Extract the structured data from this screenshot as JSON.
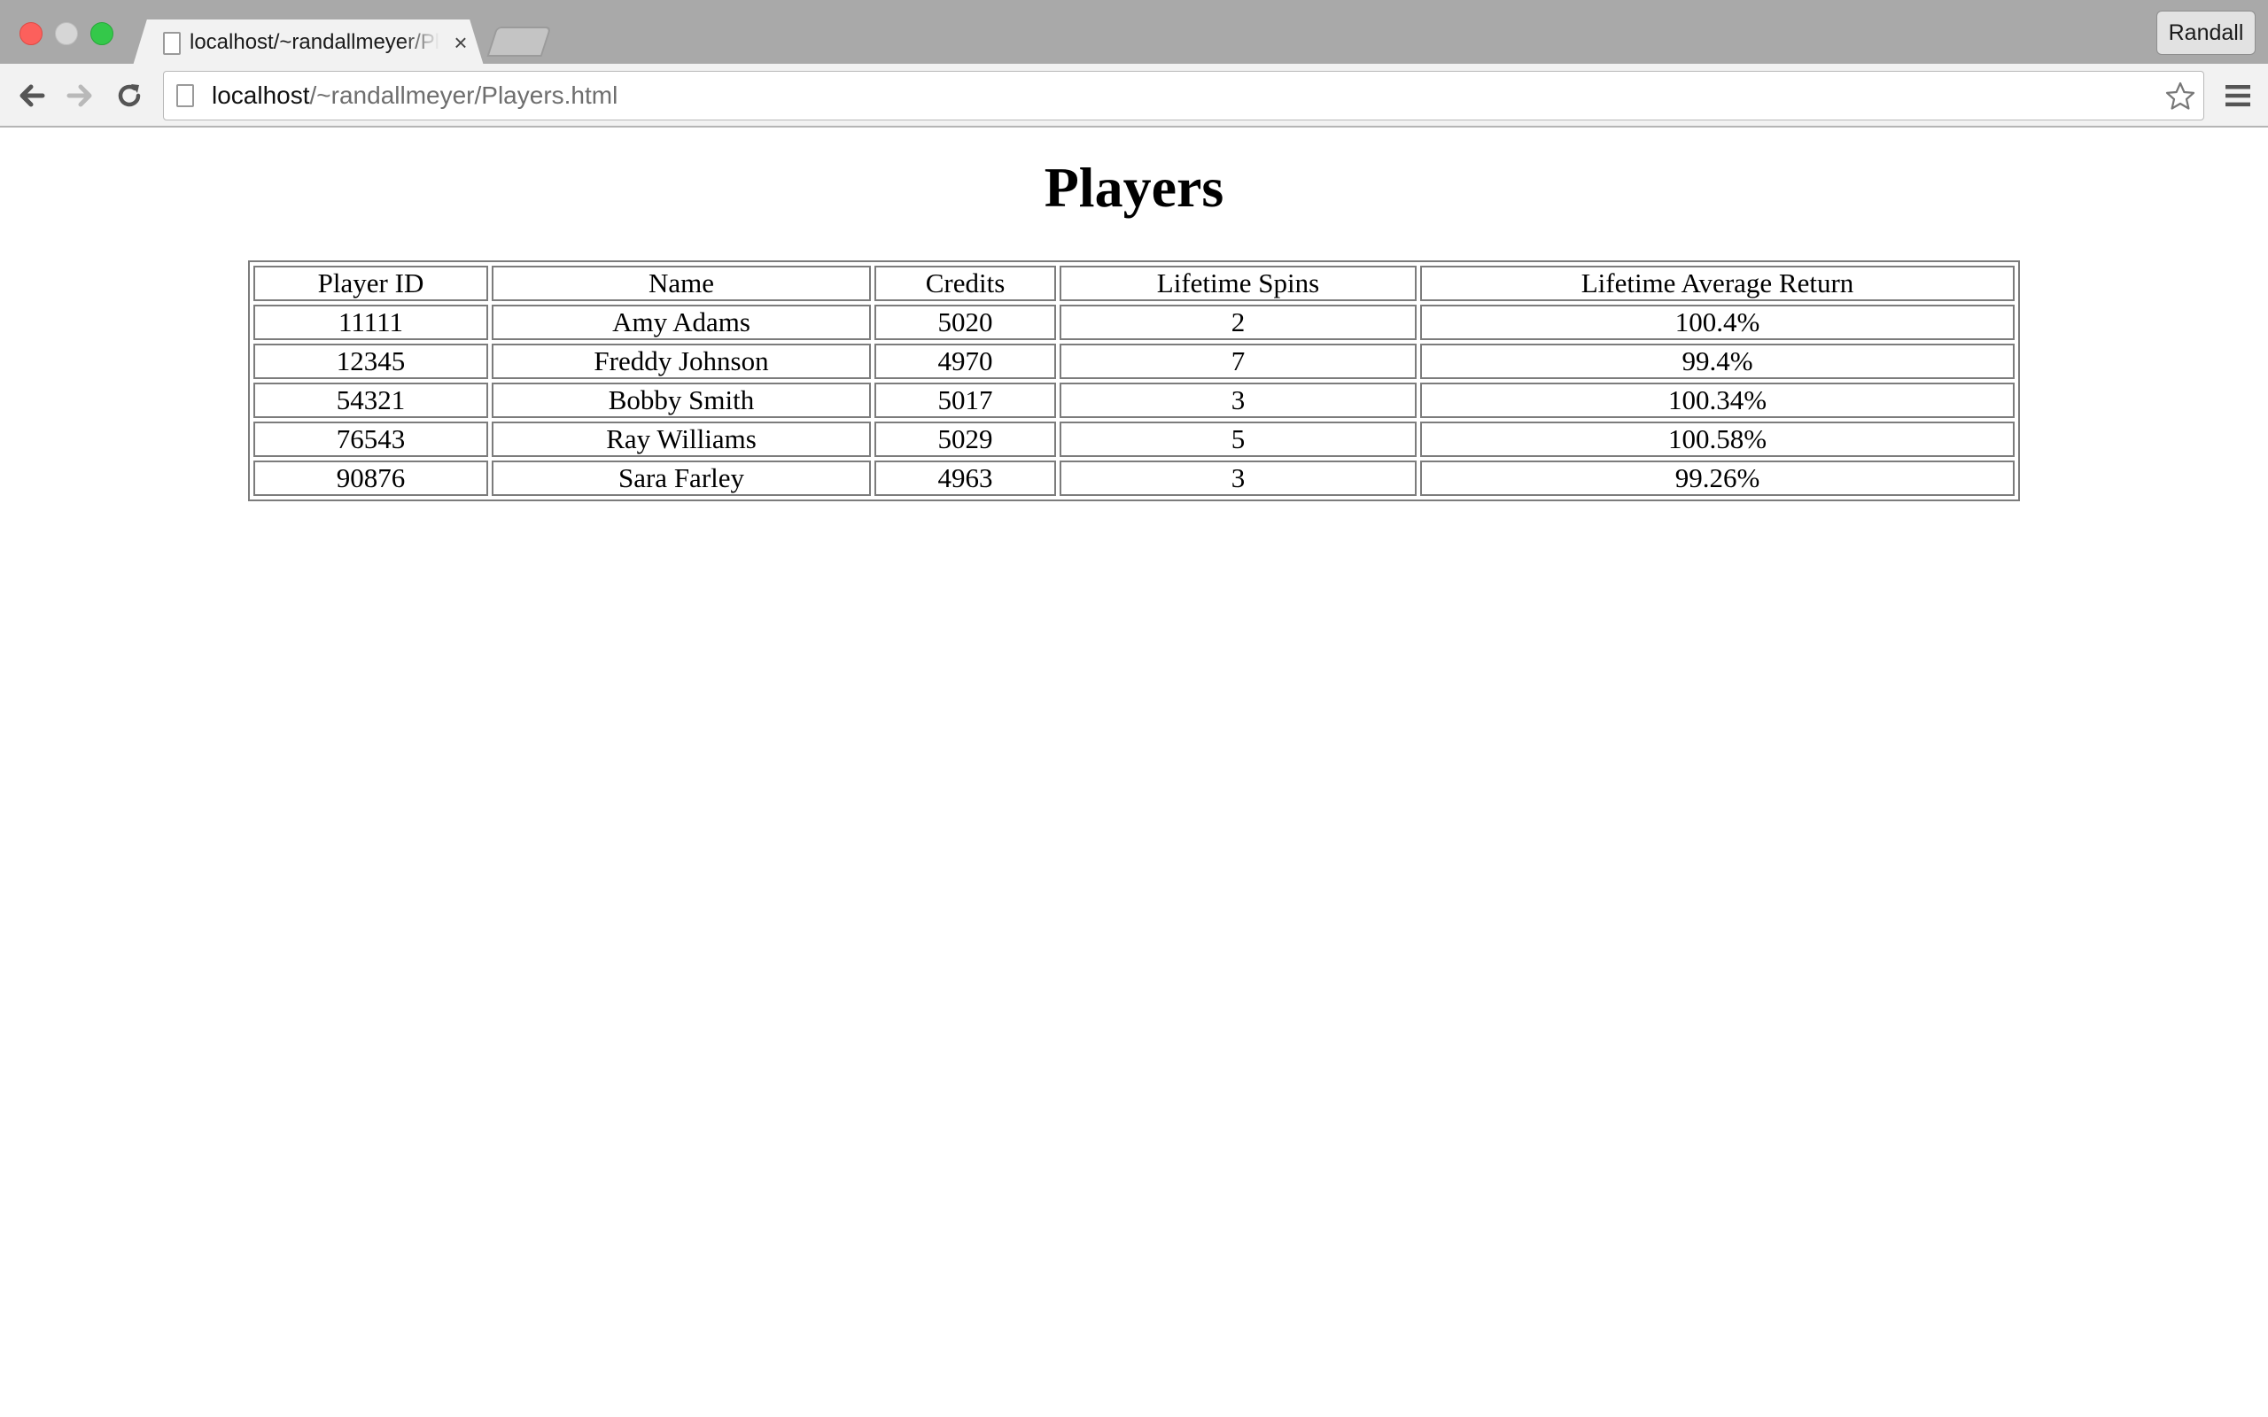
{
  "browser": {
    "tab_title": "localhost/~randallmeyer/Players.html",
    "tab_close_glyph": "×",
    "profile_name": "Randall",
    "url_host": "localhost",
    "url_path": "/~randallmeyer/Players.html",
    "icons": [
      "back-icon",
      "forward-icon",
      "reload-icon",
      "document-icon",
      "bookmark-star-icon",
      "menu-icon"
    ],
    "colors": {
      "close": "#fc605c",
      "minimize": "#d6d6d6",
      "maximize": "#34c84a"
    }
  },
  "page": {
    "title": "Players",
    "table": {
      "headers": [
        "Player ID",
        "Name",
        "Credits",
        "Lifetime Spins",
        "Lifetime Average Return"
      ],
      "rows": [
        [
          "11111",
          "Amy Adams",
          "5020",
          "2",
          "100.4%"
        ],
        [
          "12345",
          "Freddy Johnson",
          "4970",
          "7",
          "99.4%"
        ],
        [
          "54321",
          "Bobby Smith",
          "5017",
          "3",
          "100.34%"
        ],
        [
          "76543",
          "Ray Williams",
          "5029",
          "5",
          "100.58%"
        ],
        [
          "90876",
          "Sara Farley",
          "4963",
          "3",
          "99.26%"
        ]
      ]
    }
  }
}
